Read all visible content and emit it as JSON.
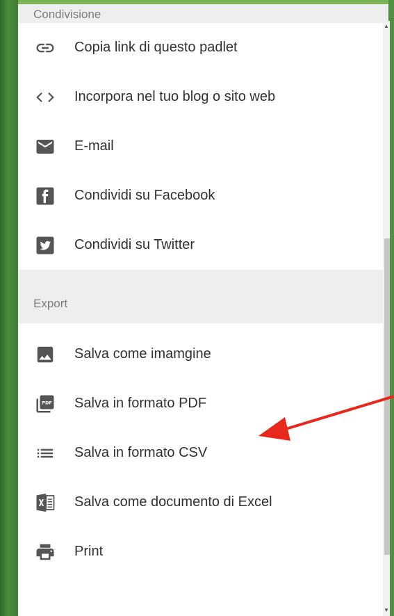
{
  "sections": {
    "share": {
      "title": "Condivisione",
      "items": [
        {
          "label": "Copia link di questo padlet",
          "icon": "link-icon"
        },
        {
          "label": "Incorpora nel tuo blog o sito web",
          "icon": "code-icon"
        },
        {
          "label": "E-mail",
          "icon": "mail-icon"
        },
        {
          "label": "Condividi su Facebook",
          "icon": "facebook-icon"
        },
        {
          "label": "Condividi su Twitter",
          "icon": "twitter-icon"
        }
      ]
    },
    "export": {
      "title": "Export",
      "items": [
        {
          "label": "Salva come imamgine",
          "icon": "image-icon"
        },
        {
          "label": "Salva in formato PDF",
          "icon": "pdf-icon"
        },
        {
          "label": "Salva in formato CSV",
          "icon": "list-icon"
        },
        {
          "label": "Salva come documento di Excel",
          "icon": "excel-icon"
        },
        {
          "label": "Print",
          "icon": "print-icon"
        }
      ]
    }
  },
  "colors": {
    "icon": "#555555",
    "text": "#303030",
    "section_bg": "#eeeeee",
    "arrow": "#e8281c",
    "frame_green": "#3f7d34"
  }
}
